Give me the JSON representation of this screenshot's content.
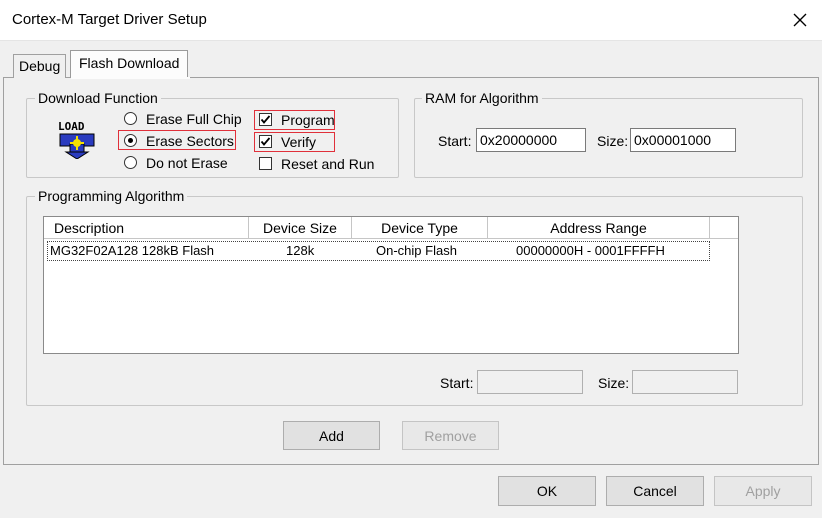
{
  "window": {
    "title": "Cortex-M Target Driver Setup",
    "close_glyph": "×"
  },
  "tabs": [
    {
      "label": "Debug",
      "active": false
    },
    {
      "label": "Flash Download",
      "active": true
    }
  ],
  "download_function": {
    "legend": "Download Function",
    "icon_text": "LOAD",
    "radios": [
      {
        "label": "Erase Full Chip",
        "checked": false
      },
      {
        "label": "Erase Sectors",
        "checked": true
      },
      {
        "label": "Do not Erase",
        "checked": false
      }
    ],
    "checks": [
      {
        "label": "Program",
        "checked": true
      },
      {
        "label": "Verify",
        "checked": true
      },
      {
        "label": "Reset and Run",
        "checked": false
      }
    ]
  },
  "ram_for_algorithm": {
    "legend": "RAM for Algorithm",
    "start_label": "Start:",
    "start_value": "0x20000000",
    "size_label": "Size:",
    "size_value": "0x00001000"
  },
  "programming_algorithm": {
    "legend": "Programming Algorithm",
    "columns": [
      "Description",
      "Device Size",
      "Device Type",
      "Address Range"
    ],
    "rows": [
      [
        "MG32F02A128 128kB Flash",
        "128k",
        "On-chip Flash",
        "00000000H - 0001FFFFH"
      ]
    ],
    "start_label": "Start:",
    "start_value": "",
    "size_label": "Size:",
    "size_value": ""
  },
  "buttons": {
    "add": "Add",
    "remove": "Remove",
    "ok": "OK",
    "cancel": "Cancel",
    "apply": "Apply"
  },
  "colors": {
    "highlight": "#e0303a",
    "dialog_bg": "#f0f0f0"
  }
}
